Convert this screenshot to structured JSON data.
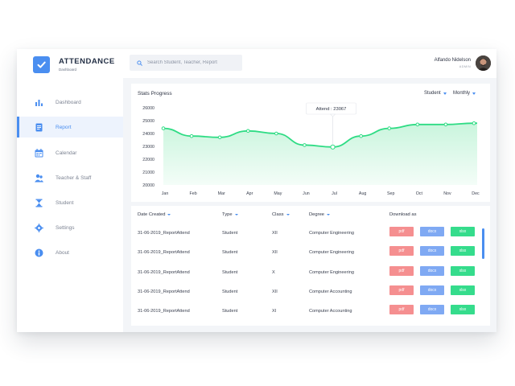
{
  "app": {
    "title": "ATTENDANCE",
    "subtitle": "Dashboard"
  },
  "search": {
    "placeholder": "Search Student, Teacher, Report",
    "value": "",
    "icon": "search-icon"
  },
  "user": {
    "name": "Alfando Nidelson",
    "role": "ADMIN"
  },
  "sidebar": {
    "items": [
      {
        "label": "Dashboard",
        "icon": "bar-chart-icon",
        "active": false
      },
      {
        "label": "Report",
        "icon": "document-icon",
        "active": true
      },
      {
        "label": "Calendar",
        "icon": "calendar-icon",
        "active": false
      },
      {
        "label": "Teacher & Staff",
        "icon": "users-icon",
        "active": false
      },
      {
        "label": "Student",
        "icon": "hourglass-icon",
        "active": false
      },
      {
        "label": "Settings",
        "icon": "gear-icon",
        "active": false
      },
      {
        "label": "About",
        "icon": "info-icon",
        "active": false
      }
    ]
  },
  "stats": {
    "title": "Stats Progress",
    "filter_entity": "Student",
    "filter_period": "Monthly",
    "tooltip": "Attend : 23067"
  },
  "chart_data": {
    "type": "area",
    "title": "Stats Progress",
    "categories": [
      "Jan",
      "Feb",
      "Mar",
      "Apr",
      "May",
      "Jun",
      "Jul",
      "Aug",
      "Sep",
      "Oct",
      "Nov",
      "Dec"
    ],
    "series": [
      {
        "values": [
          24400,
          23800,
          23700,
          24200,
          24000,
          23100,
          22950,
          23800,
          24400,
          24700,
          24700,
          24800
        ]
      }
    ],
    "yticks": [
      20000,
      21000,
      22000,
      23000,
      24000,
      25000,
      26000
    ],
    "ylim": [
      20000,
      26000
    ],
    "grid": false,
    "highlight_index": 6,
    "line_color": "#2edc84",
    "fill_color": "#e6faef"
  },
  "table": {
    "columns": [
      "Date Created",
      "Type",
      "Class",
      "Degree",
      "Download as"
    ],
    "sortable": [
      true,
      true,
      true,
      true,
      false
    ],
    "download_labels": [
      "pdf",
      "docx",
      "xlsx"
    ],
    "rows": [
      {
        "date": "31-06-2019_ReportAttend",
        "type": "Student",
        "class": "XII",
        "degree": "Computer Engineering"
      },
      {
        "date": "31-06-2019_ReportAttend",
        "type": "Student",
        "class": "XII",
        "degree": "Computer Engineering"
      },
      {
        "date": "31-06-2019_ReportAttend",
        "type": "Student",
        "class": "X",
        "degree": "Computer Engineering"
      },
      {
        "date": "31-06-2019_ReportAttend",
        "type": "Student",
        "class": "XII",
        "degree": "Computer Accounting"
      },
      {
        "date": "31-06-2019_ReportAttend",
        "type": "Student",
        "class": "XI",
        "degree": "Computer Accounting"
      }
    ]
  },
  "colors": {
    "accent": "#4a8ef0",
    "pdf": "#f58f90",
    "docx": "#7fa9f3",
    "xlsx": "#35dc8c"
  }
}
